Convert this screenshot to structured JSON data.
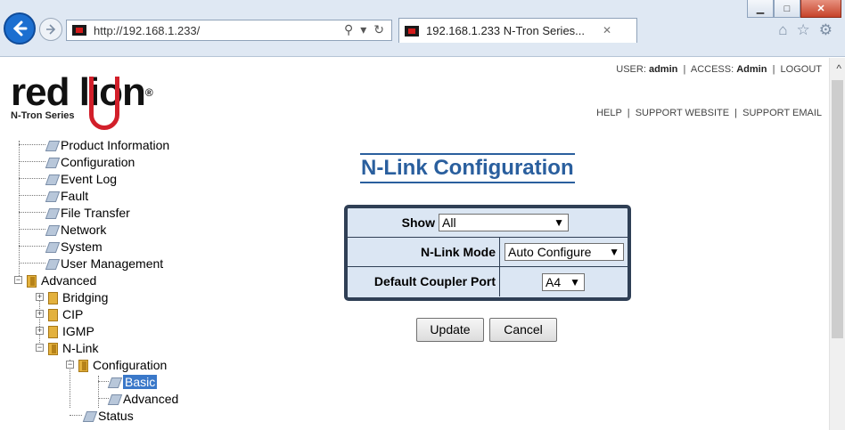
{
  "browser": {
    "url_prefix": "http://",
    "url_host": "192.168.1.233/",
    "tab_title": "192.168.1.233 N-Tron Series...",
    "tab_close": "✕",
    "window_buttons": {
      "minimize": "▁",
      "maximize": "□",
      "close": "✕"
    },
    "icons": [
      "back-arrow-icon",
      "forward-arrow-icon",
      "search-icon",
      "refresh-icon",
      "home-icon",
      "favorites-star-icon",
      "settings-gear-icon"
    ]
  },
  "header": {
    "logo_text": "red lion",
    "logo_sub": "N-Tron Series",
    "user_label": "USER:",
    "user": "admin",
    "access_label": "ACCESS:",
    "access": "Admin",
    "logout": "LOGOUT",
    "help": "HELP",
    "support_website": "SUPPORT WEBSITE",
    "support_email": "SUPPORT EMAIL"
  },
  "tree": {
    "items": [
      {
        "label": "Product Information"
      },
      {
        "label": "Configuration"
      },
      {
        "label": "Event Log"
      },
      {
        "label": "Fault"
      },
      {
        "label": "File Transfer"
      },
      {
        "label": "Network"
      },
      {
        "label": "System"
      },
      {
        "label": "User Management"
      },
      {
        "label": "Advanced"
      },
      {
        "label": "Bridging"
      },
      {
        "label": "CIP"
      },
      {
        "label": "IGMP"
      },
      {
        "label": "N-Link"
      },
      {
        "label": "Configuration"
      },
      {
        "label": "Basic",
        "selected": true
      },
      {
        "label": "Advanced"
      },
      {
        "label": "Status"
      }
    ]
  },
  "main": {
    "title": "N-Link Configuration",
    "form": {
      "show_label": "Show",
      "show_value": "All",
      "mode_label": "N-Link Mode",
      "mode_value": "Auto Configure",
      "coupler_label": "Default Coupler Port",
      "coupler_value": "A4"
    },
    "update_button": "Update",
    "cancel_button": "Cancel"
  },
  "colors": {
    "accent": "#2a5f9e",
    "form_bg": "#dbe6f3",
    "form_border": "#2f3f55",
    "selected": "#3a78c9",
    "logo_red": "#d21f2a"
  }
}
